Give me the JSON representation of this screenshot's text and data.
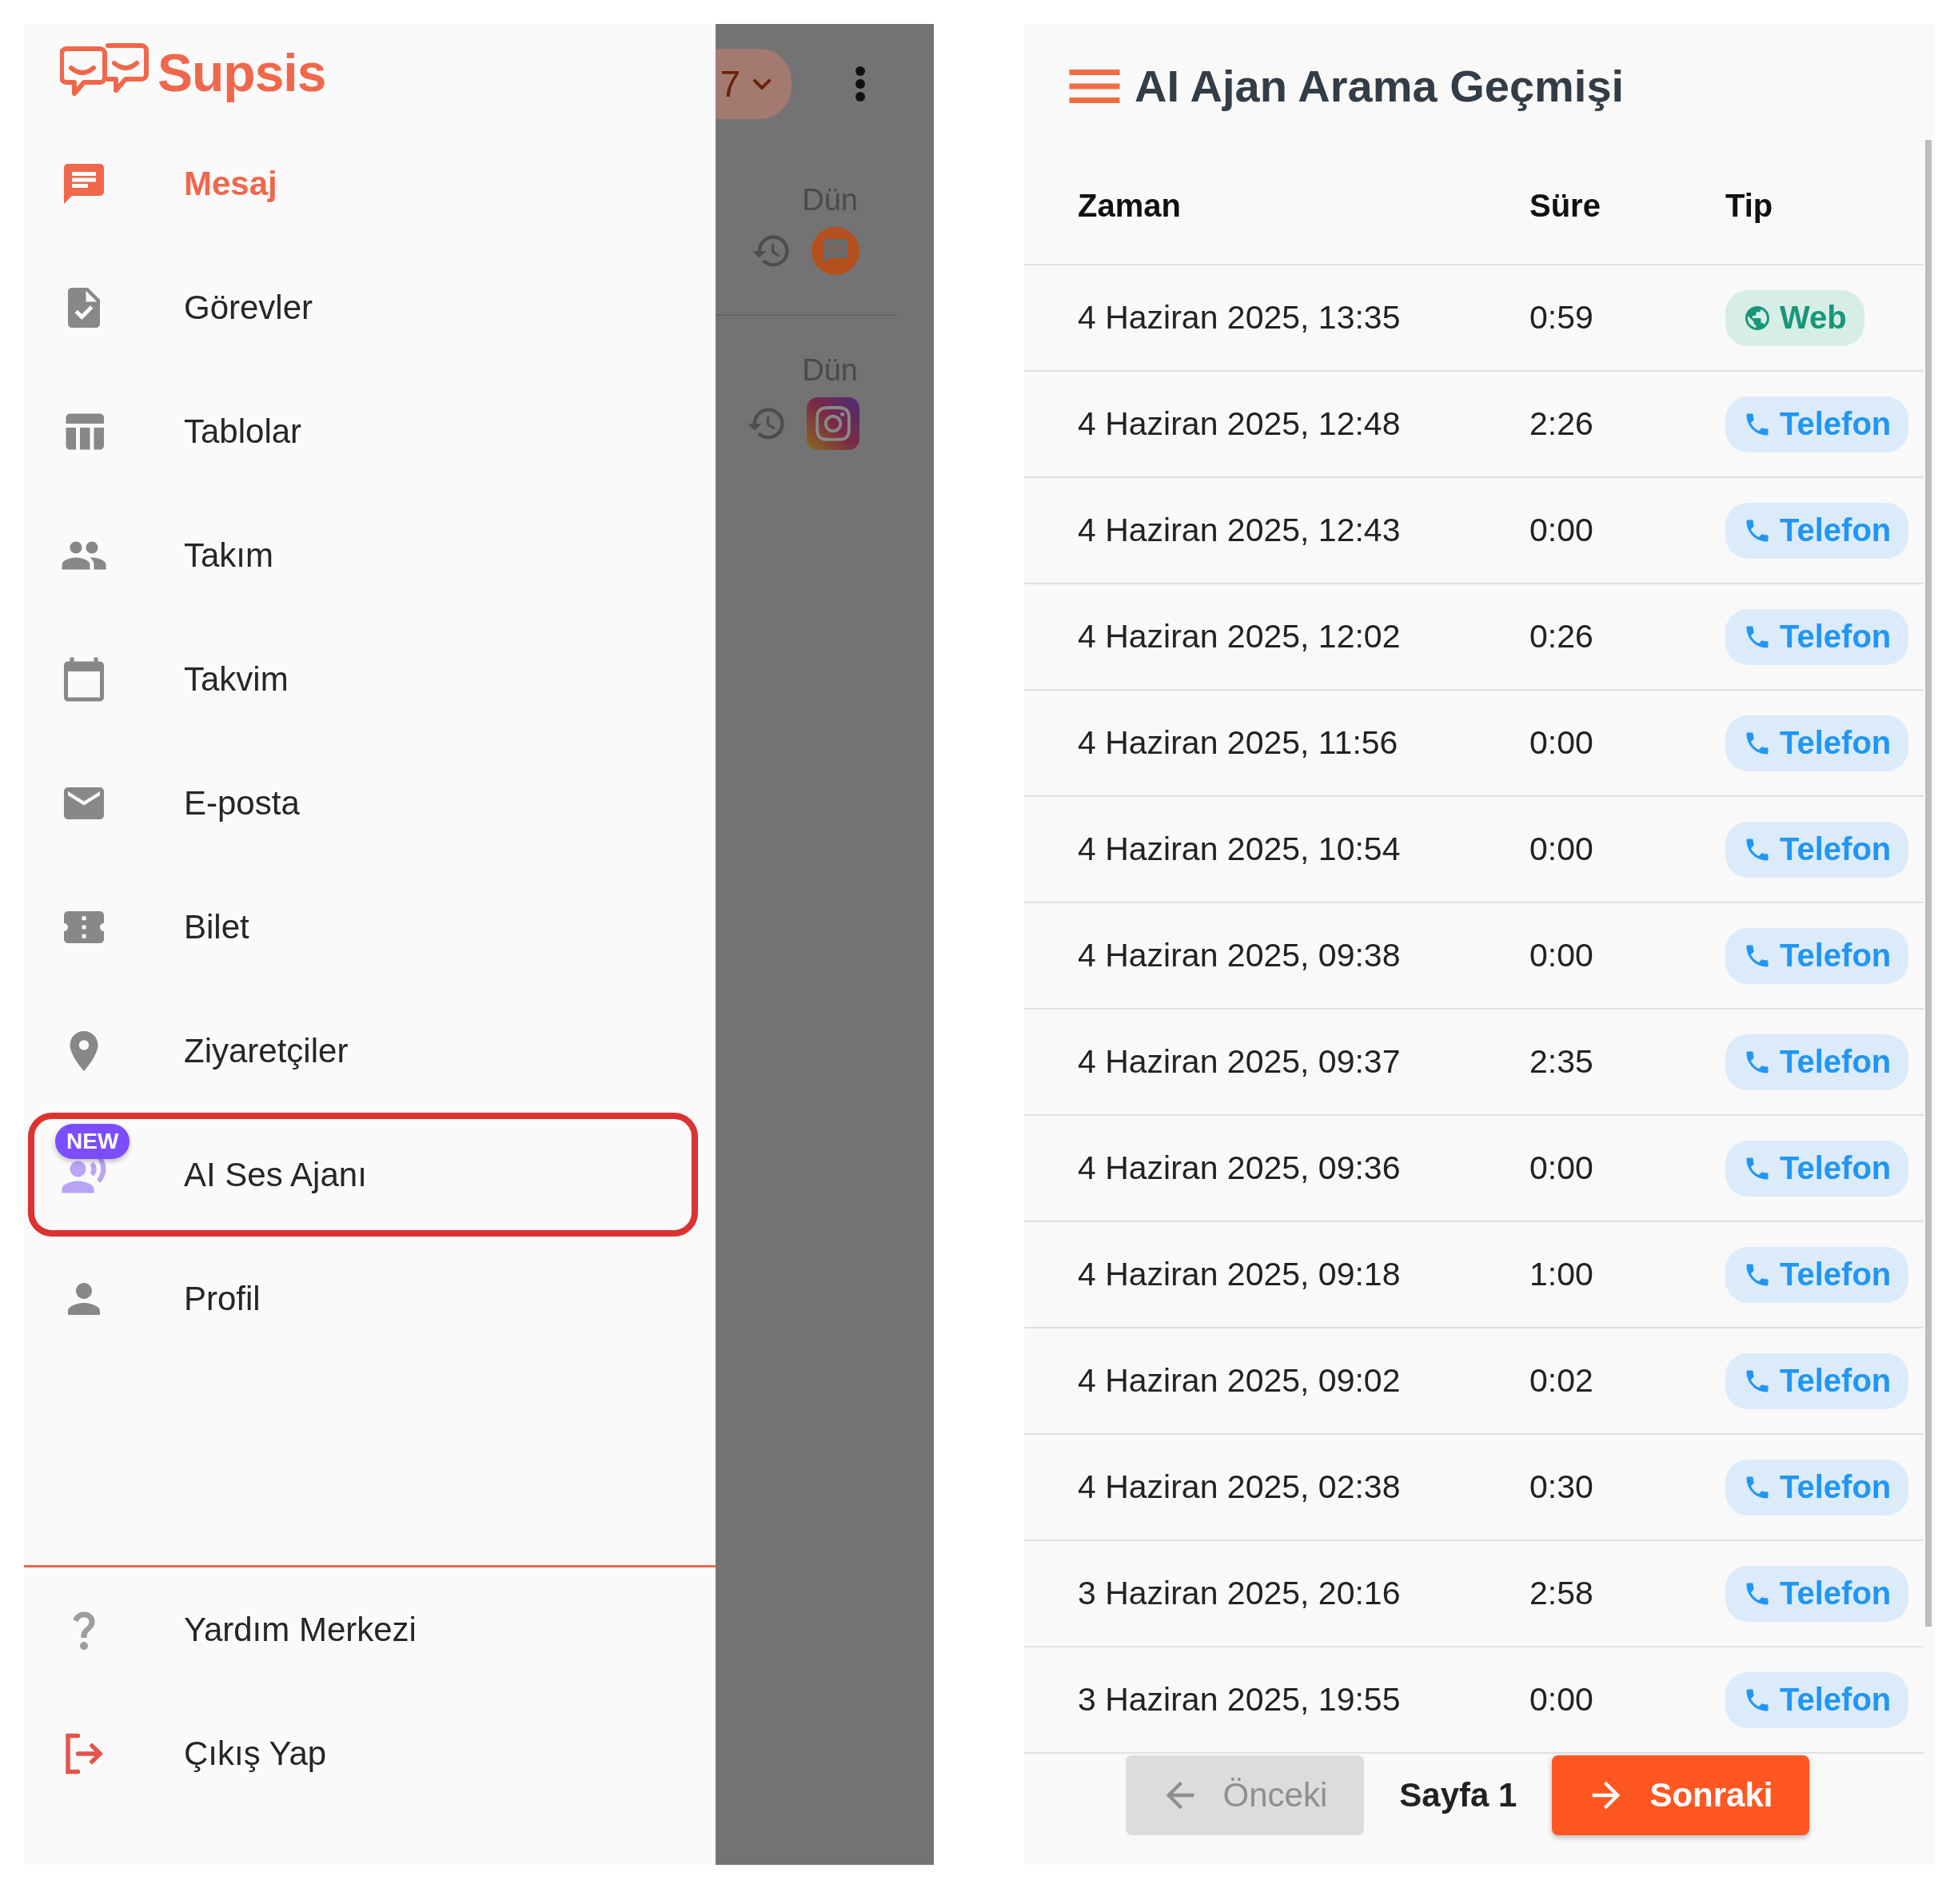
{
  "drawer": {
    "logo": "Supsis",
    "items": [
      {
        "label": "Mesaj",
        "selected": true,
        "highlighted": false
      },
      {
        "label": "Görevler",
        "selected": false,
        "highlighted": false
      },
      {
        "label": "Tablolar",
        "selected": false,
        "highlighted": false
      },
      {
        "label": "Takım",
        "selected": false,
        "highlighted": false
      },
      {
        "label": "Takvim",
        "selected": false,
        "highlighted": false
      },
      {
        "label": "E-posta",
        "selected": false,
        "highlighted": false
      },
      {
        "label": "Bilet",
        "selected": false,
        "highlighted": false
      },
      {
        "label": "Ziyaretçiler",
        "selected": false,
        "highlighted": false
      },
      {
        "label": "AI Ses Ajanı",
        "selected": false,
        "highlighted": true,
        "badge": "NEW"
      },
      {
        "label": "Profil",
        "selected": false,
        "highlighted": false
      }
    ],
    "footer_items": [
      {
        "label": "Yardım Merkezi"
      },
      {
        "label": "Çıkış Yap"
      }
    ]
  },
  "background_screen": {
    "chip": "7",
    "conversations": [
      {
        "time": "Dün",
        "kind": "chat"
      },
      {
        "time": "Dün",
        "kind": "instagram"
      }
    ]
  },
  "call_history": {
    "title": "AI Ajan Arama Geçmişi",
    "columns": [
      "Zaman",
      "Süre",
      "Tip"
    ],
    "rows": [
      {
        "time": "4 Haziran 2025, 13:35",
        "duration": "0:59",
        "type": {
          "kind": "web",
          "label": "Web"
        }
      },
      {
        "time": "4 Haziran 2025, 12:48",
        "duration": "2:26",
        "type": {
          "kind": "phone",
          "label": "Telefon"
        }
      },
      {
        "time": "4 Haziran 2025, 12:43",
        "duration": "0:00",
        "type": {
          "kind": "phone",
          "label": "Telefon"
        }
      },
      {
        "time": "4 Haziran 2025, 12:02",
        "duration": "0:26",
        "type": {
          "kind": "phone",
          "label": "Telefon"
        }
      },
      {
        "time": "4 Haziran 2025, 11:56",
        "duration": "0:00",
        "type": {
          "kind": "phone",
          "label": "Telefon"
        }
      },
      {
        "time": "4 Haziran 2025, 10:54",
        "duration": "0:00",
        "type": {
          "kind": "phone",
          "label": "Telefon"
        }
      },
      {
        "time": "4 Haziran 2025, 09:38",
        "duration": "0:00",
        "type": {
          "kind": "phone",
          "label": "Telefon"
        }
      },
      {
        "time": "4 Haziran 2025, 09:37",
        "duration": "2:35",
        "type": {
          "kind": "phone",
          "label": "Telefon"
        }
      },
      {
        "time": "4 Haziran 2025, 09:36",
        "duration": "0:00",
        "type": {
          "kind": "phone",
          "label": "Telefon"
        }
      },
      {
        "time": "4 Haziran 2025, 09:18",
        "duration": "1:00",
        "type": {
          "kind": "phone",
          "label": "Telefon"
        }
      },
      {
        "time": "4 Haziran 2025, 09:02",
        "duration": "0:02",
        "type": {
          "kind": "phone",
          "label": "Telefon"
        }
      },
      {
        "time": "4 Haziran 2025, 02:38",
        "duration": "0:30",
        "type": {
          "kind": "phone",
          "label": "Telefon"
        }
      },
      {
        "time": "3 Haziran 2025, 20:16",
        "duration": "2:58",
        "type": {
          "kind": "phone",
          "label": "Telefon"
        }
      },
      {
        "time": "3 Haziran 2025, 19:55",
        "duration": "0:00",
        "type": {
          "kind": "phone",
          "label": "Telefon"
        }
      }
    ],
    "pagination": {
      "previous": {
        "label": "Önceki",
        "disabled": true
      },
      "page": "Sayfa 1",
      "next": {
        "label": "Sonraki",
        "disabled": false
      }
    }
  }
}
